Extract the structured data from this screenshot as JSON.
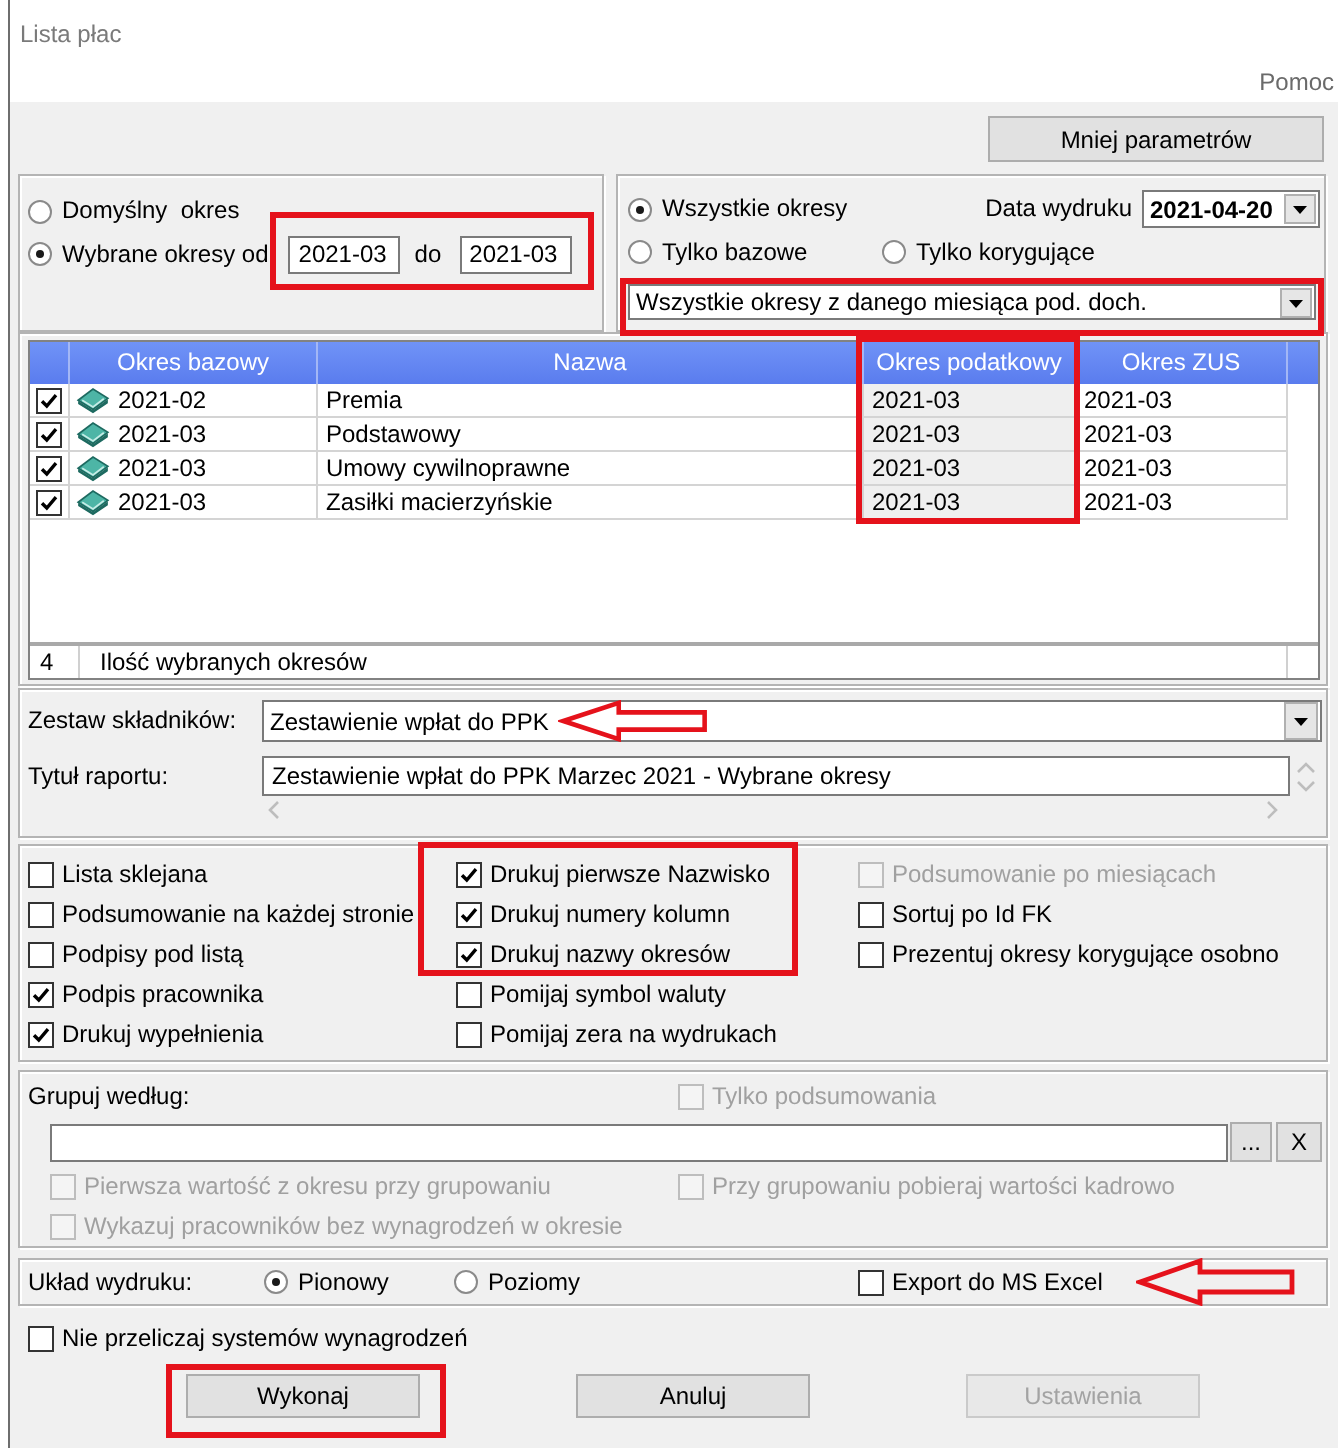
{
  "window": {
    "title": "Lista płac"
  },
  "menu": [
    "Pomoc"
  ],
  "toggle_button": {
    "label": "Mniej parametrów"
  },
  "period_range": {
    "options": [
      {
        "label": "Domyślny  okres",
        "selected": false
      },
      {
        "label": "Wybrane okresy od",
        "selected": true,
        "range": {
          "from": "2021-03",
          "to_label": "do",
          "to": "2021-03",
          "highlighted": true
        }
      }
    ]
  },
  "period_filter": {
    "options": [
      {
        "label": "Wszystkie okresy",
        "selected": true
      },
      {
        "label": "Tylko bazowe",
        "selected": false
      },
      {
        "label": "Tylko korygujące",
        "selected": false
      }
    ],
    "print_date": {
      "label": "Data wydruku",
      "value": "2021-04-20"
    },
    "scope": {
      "value": "Wszystkie okresy z danego miesiąca pod. doch.",
      "highlighted": true
    }
  },
  "periods_table": {
    "columns": [
      {
        "label": "Okres bazowy",
        "shaded": false,
        "highlighted": false
      },
      {
        "label": "Nazwa",
        "shaded": false,
        "highlighted": false
      },
      {
        "label": "Okres podatkowy",
        "shaded": true,
        "highlighted": true
      },
      {
        "label": "Okres ZUS",
        "shaded": false,
        "highlighted": false
      }
    ],
    "rows": [
      {
        "checked": true,
        "cells": [
          "2021-02",
          "Premia",
          "2021-03",
          "2021-03"
        ]
      },
      {
        "checked": true,
        "cells": [
          "2021-03",
          "Podstawowy",
          "2021-03",
          "2021-03"
        ]
      },
      {
        "checked": true,
        "cells": [
          "2021-03",
          "Umowy cywilnoprawne",
          "2021-03",
          "2021-03"
        ]
      },
      {
        "checked": true,
        "cells": [
          "2021-03",
          "Zasiłki macierzyńskie",
          "2021-03",
          "2021-03"
        ]
      }
    ],
    "footer": {
      "count": "4",
      "label": "Ilość wybranych okresów"
    }
  },
  "component_set": {
    "label": "Zestaw składników:",
    "value": "Zestawienie wpłat do PPK",
    "arrow": true
  },
  "report_title": {
    "label": "Tytuł raportu:",
    "value": "Zestawienie wpłat do PPK Marzec 2021 - Wybrane okresy"
  },
  "options": {
    "columns": [
      [
        {
          "label": "Lista sklejana",
          "checked": false,
          "disabled": false,
          "highlighted": false
        },
        {
          "label": "Podsumowanie na każdej stronie",
          "checked": false,
          "disabled": false,
          "highlighted": false
        },
        {
          "label": "Podpisy pod listą",
          "checked": false,
          "disabled": false,
          "highlighted": false
        },
        {
          "label": "Podpis pracownika",
          "checked": true,
          "disabled": false,
          "highlighted": false
        },
        {
          "label": "Drukuj wypełnienia",
          "checked": true,
          "disabled": false,
          "highlighted": false
        }
      ],
      [
        {
          "label": "Drukuj pierwsze Nazwisko",
          "checked": true,
          "disabled": false,
          "highlighted": true
        },
        {
          "label": "Drukuj numery kolumn",
          "checked": true,
          "disabled": false,
          "highlighted": true
        },
        {
          "label": "Drukuj nazwy okresów",
          "checked": true,
          "disabled": false,
          "highlighted": true
        },
        {
          "label": "Pomijaj symbol waluty",
          "checked": false,
          "disabled": false,
          "highlighted": false
        },
        {
          "label": "Pomijaj zera na wydrukach",
          "checked": false,
          "disabled": false,
          "highlighted": false
        }
      ],
      [
        {
          "label": "Podsumowanie po miesiącach",
          "checked": false,
          "disabled": true,
          "highlighted": false
        },
        {
          "label": "Sortuj po Id FK",
          "checked": false,
          "disabled": false,
          "highlighted": false
        },
        {
          "label": "Prezentuj okresy korygujące osobno",
          "checked": false,
          "disabled": false,
          "highlighted": false
        }
      ]
    ]
  },
  "grouping": {
    "label": "Grupuj według:",
    "summary_only": {
      "label": "Tylko podsumowania",
      "checked": false,
      "disabled": true
    },
    "browse_button": "...",
    "clear_button": "X",
    "options": [
      {
        "label": "Pierwsza wartość z okresu przy grupowaniu",
        "checked": false,
        "disabled": true
      },
      {
        "label": "Przy grupowaniu pobieraj wartości kadrowo",
        "checked": false,
        "disabled": true
      },
      {
        "label": "Wykazuj pracowników bez wynagrodzeń w okresie",
        "checked": false,
        "disabled": true
      }
    ]
  },
  "print_layout": {
    "label": "Układ wydruku:",
    "options": [
      {
        "label": "Pionowy",
        "selected": true
      },
      {
        "label": "Poziomy",
        "selected": false
      }
    ],
    "export": {
      "label": "Export do MS Excel",
      "checked": false,
      "arrow": true
    }
  },
  "no_recalc": {
    "label": "Nie przeliczaj systemów wynagrodzeń",
    "checked": false
  },
  "buttons": [
    {
      "label": "Wykonaj",
      "disabled": false,
      "highlighted": true
    },
    {
      "label": "Anuluj",
      "disabled": false,
      "highlighted": false
    },
    {
      "label": "Ustawienia",
      "disabled": true,
      "highlighted": false
    }
  ]
}
